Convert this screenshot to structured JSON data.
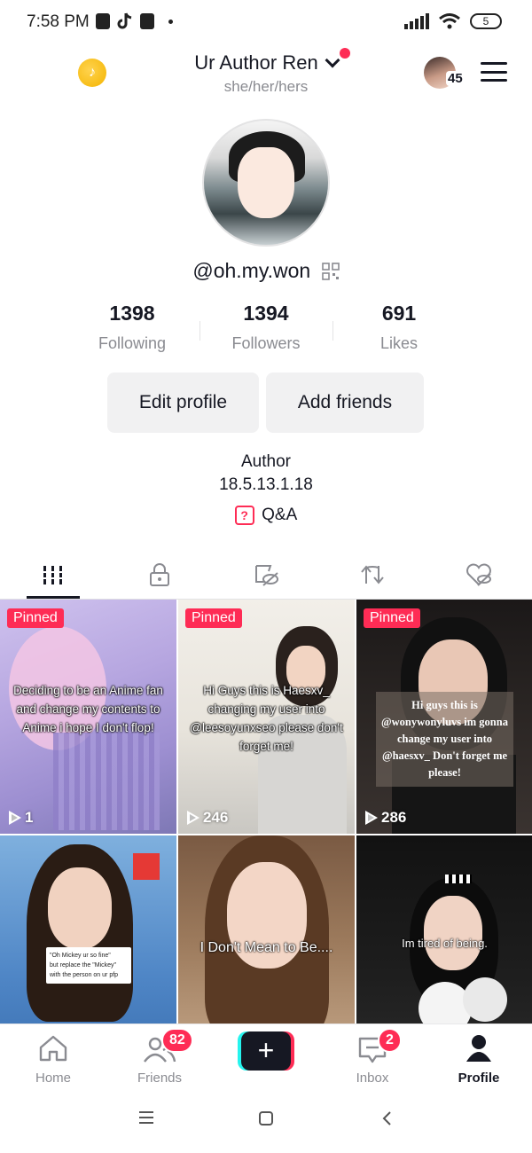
{
  "status_bar": {
    "time": "7:58 PM",
    "battery": "5"
  },
  "header": {
    "display_name": "Ur Author Ren",
    "pronouns": "she/her/hers",
    "friend_requests": "45"
  },
  "profile": {
    "handle": "@oh.my.won",
    "stats": [
      {
        "value": "1398",
        "label": "Following"
      },
      {
        "value": "1394",
        "label": "Followers"
      },
      {
        "value": "691",
        "label": "Likes"
      }
    ],
    "edit_button": "Edit profile",
    "add_friends_button": "Add friends",
    "bio_line1": "Author",
    "bio_line2": "18.5.13.1.18",
    "qa_label": "Q&A"
  },
  "tabs": [
    "videos-grid-icon",
    "lock-icon",
    "eye-slash-icon",
    "repost-icon",
    "heart-slash-icon"
  ],
  "videos": [
    {
      "pinned": "Pinned",
      "caption": "Deciding to be an Anime fan and change my contents to Anime i hope I don't flop!",
      "views": "1"
    },
    {
      "pinned": "Pinned",
      "caption": "Hi Guys this is Haesxv_ changing my user into @leesoyunxseo please don't forget me!",
      "views": "246"
    },
    {
      "pinned": "Pinned",
      "caption": "Hi guys this is @wonywonyluvs im gonna change my user into @haesxv_ Don't forget me please!",
      "views": "286"
    },
    {
      "caption_l1": "\"Oh Mickey ur so fine\"",
      "caption_l2": "but replace the \"Mickey\"",
      "caption_l3": "with the person on ur pfp"
    },
    {
      "caption": "I Don't Mean to Be...."
    },
    {
      "caption": "Im tired of being."
    }
  ],
  "bottom_nav": {
    "home": "Home",
    "friends": "Friends",
    "friends_badge": "82",
    "inbox": "Inbox",
    "inbox_badge": "2",
    "profile": "Profile"
  },
  "colors": {
    "accent": "#fe2c55",
    "cyan": "#25f4ee",
    "text": "#161823",
    "muted": "#8a8b91"
  }
}
